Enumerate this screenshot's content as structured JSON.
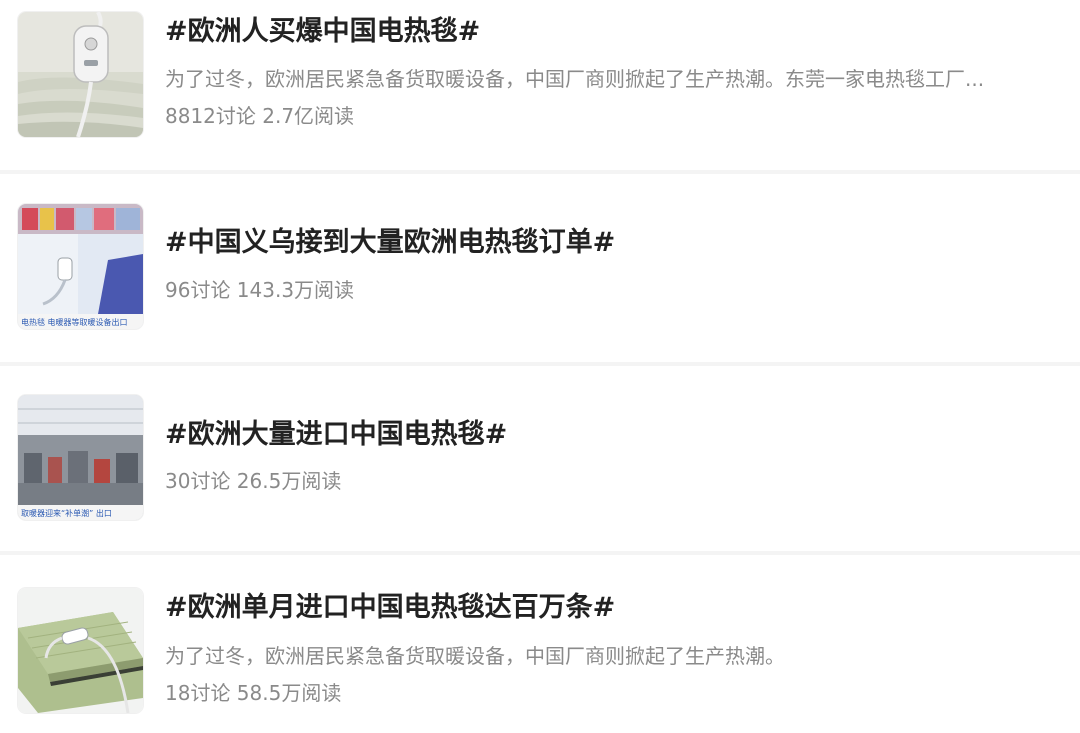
{
  "topics": [
    {
      "title": "#欧洲人买爆中国电热毯#",
      "description": "为了过冬，欧洲居民紧急备货取暖设备，中国厂商则掀起了生产热潮。东莞一家电热毯工厂...",
      "stats": "8812讨论 2.7亿阅读",
      "thumb_icon": "electric-blanket-photo"
    },
    {
      "title": "#中国义乌接到大量欧洲电热毯订单#",
      "stats": "96讨论 143.3万阅读",
      "thumb_icon": "blanket-store-photo",
      "thumb_caption": "电热毯 电暖器等取暖设备出口"
    },
    {
      "title": "#欧洲大量进口中国电热毯#",
      "stats": "30讨论 26.5万阅读",
      "thumb_icon": "factory-floor-photo",
      "thumb_caption": "取暖器迎来“补单潮” 出口"
    },
    {
      "title": "#欧洲单月进口中国电热毯达百万条#",
      "description": "为了过冬，欧洲居民紧急备货取暖设备，中国厂商则掀起了生产热潮。",
      "stats": "18讨论 58.5万阅读",
      "thumb_icon": "green-blanket-photo"
    }
  ]
}
